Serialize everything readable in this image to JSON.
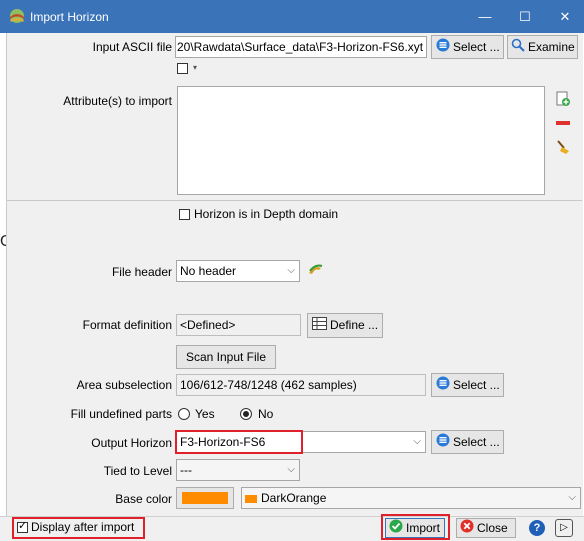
{
  "window": {
    "title": "Import Horizon",
    "min": "—",
    "max": "☐",
    "close": "✕"
  },
  "form": {
    "input_ascii_label": "Input ASCII file",
    "input_ascii_value": "20\\Rawdata\\Surface_data\\F3-Horizon-FS6.xyt",
    "select_label": "Select ...",
    "examine_label": "Examine",
    "attributes_label": "Attribute(s) to import",
    "depth_domain_label": "Horizon is in Depth domain",
    "file_header_label": "File header",
    "file_header_value": "No header",
    "format_label": "Format definition",
    "format_value": "<Defined>",
    "define_label": "Define ...",
    "scan_label": "Scan Input File",
    "area_label": "Area subselection",
    "area_value": "106/612-748/1248 (462 samples)",
    "fill_label": "Fill undefined parts",
    "fill_yes": "Yes",
    "fill_no": "No",
    "output_label": "Output Horizon",
    "output_value": "F3-Horizon-FS6",
    "tied_label": "Tied to Level",
    "tied_value": "---",
    "base_color_label": "Base color",
    "base_color_name": "DarkOrange",
    "base_color_hex": "#ff8c00"
  },
  "footer": {
    "display_after_label": "Display after import",
    "import_label": "Import",
    "close_label": "Close",
    "help_label": "?",
    "play_label": "▷"
  },
  "edge_text": "O"
}
